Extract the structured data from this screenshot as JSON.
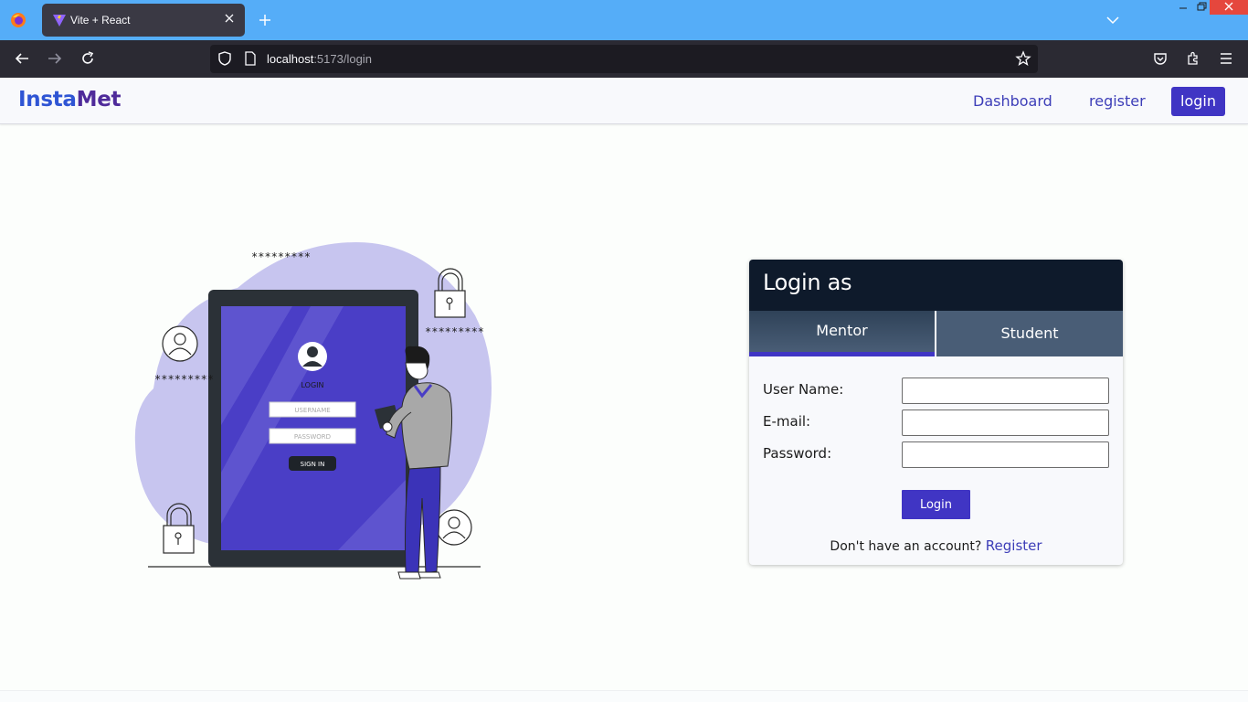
{
  "browser": {
    "tab_title": "Vite + React",
    "url_host": "localhost",
    "url_path": ":5173/login"
  },
  "header": {
    "brand_part1": "Insta",
    "brand_part2": "Met",
    "nav_dashboard": "Dashboard",
    "nav_register": "register",
    "nav_login": "login"
  },
  "illustration": {
    "mask_top": "*********",
    "mask_right": "*********",
    "mask_left": "*********",
    "screen_heading": "LOGIN",
    "screen_username_placeholder": "USERNAME",
    "screen_password_placeholder": "PASSWORD",
    "screen_button": "SIGN IN"
  },
  "login_card": {
    "title": "Login as",
    "tabs": [
      {
        "label": "Mentor",
        "active": true
      },
      {
        "label": "Student",
        "active": false
      }
    ],
    "fields": [
      {
        "label": "User Name:",
        "value": ""
      },
      {
        "label": "E-mail:",
        "value": ""
      },
      {
        "label": "Password:",
        "value": ""
      }
    ],
    "submit_label": "Login",
    "footer_text": "Don't have an account?",
    "footer_link": "Register"
  },
  "colors": {
    "accent": "#4035c4",
    "card_header": "#0e1a2b",
    "tab_bg": "#495d76",
    "browser_tabbar": "#55adf8",
    "illustration_blob": "#c7c5ef"
  }
}
